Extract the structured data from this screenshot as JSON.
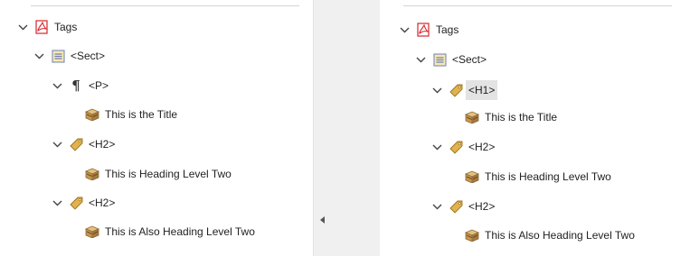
{
  "left_tree": {
    "root": {
      "label": "Tags",
      "icon": "pdf-icon"
    },
    "sect": {
      "label": "<Sect>",
      "icon": "section-icon"
    },
    "p": {
      "label": "<P>",
      "icon": "paragraph-icon"
    },
    "title_content": {
      "label": "This is the Title",
      "icon": "content-box-icon"
    },
    "h2_a": {
      "label": "<H2>",
      "icon": "tag-icon"
    },
    "h2_a_content": {
      "label": "This is Heading Level Two",
      "icon": "content-box-icon"
    },
    "h2_b": {
      "label": "<H2>",
      "icon": "tag-icon"
    },
    "h2_b_content": {
      "label": "This is Also Heading Level Two",
      "icon": "content-box-icon"
    }
  },
  "right_tree": {
    "root": {
      "label": "Tags",
      "icon": "pdf-icon"
    },
    "sect": {
      "label": "<Sect>",
      "icon": "section-icon"
    },
    "h1": {
      "label": "<H1>",
      "icon": "tag-icon",
      "selected": true
    },
    "title_content": {
      "label": "This is the Title",
      "icon": "content-box-icon"
    },
    "h2_a": {
      "label": "<H2>",
      "icon": "tag-icon"
    },
    "h2_a_content": {
      "label": "This is Heading Level Two",
      "icon": "content-box-icon"
    },
    "h2_b": {
      "label": "<H2>",
      "icon": "tag-icon"
    },
    "h2_b_content": {
      "label": "This is Also Heading Level Two",
      "icon": "content-box-icon"
    }
  },
  "colors": {
    "pdf_red": "#d7262c",
    "tag_gold": "#d9a441",
    "box_brown": "#b9874b",
    "selection": "#e3e3e3"
  }
}
